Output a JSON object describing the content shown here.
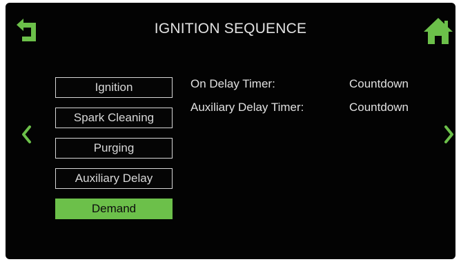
{
  "header": {
    "title": "IGNITION SEQUENCE",
    "back_icon": "back-arrow-icon",
    "home_icon": "home-icon"
  },
  "nav": {
    "prev_icon": "chevron-left-icon",
    "next_icon": "chevron-right-icon"
  },
  "steps": [
    {
      "label": "Ignition",
      "active": false
    },
    {
      "label": "Spark Cleaning",
      "active": false
    },
    {
      "label": "Purging",
      "active": false
    },
    {
      "label": "Auxiliary Delay",
      "active": false
    },
    {
      "label": "Demand",
      "active": true
    }
  ],
  "details": [
    {
      "label": "On Delay Timer:",
      "value": "Countdown"
    },
    {
      "label": "Auxiliary Delay Timer:",
      "value": "Countdown"
    }
  ],
  "colors": {
    "accent": "#6cc04a",
    "background": "#030303",
    "text": "#e0e0e0"
  }
}
